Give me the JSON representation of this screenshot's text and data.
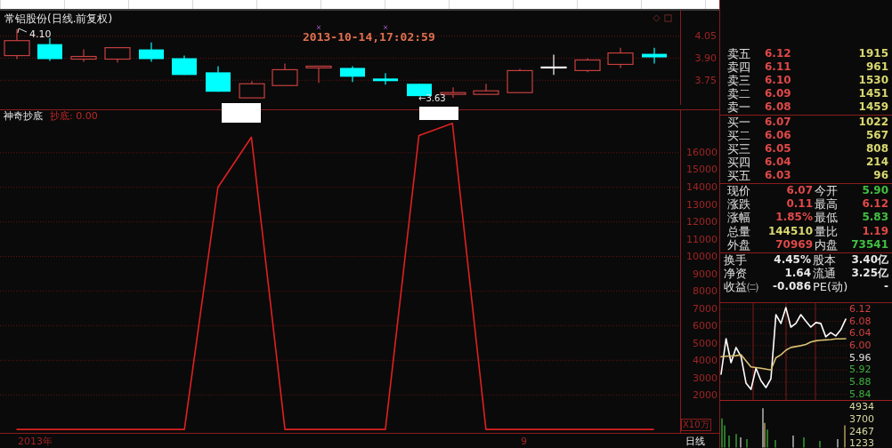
{
  "price_chart": {
    "title": "常铝股份(日线.前复权)",
    "high_label": "4.10",
    "low_label": "←3.63",
    "timestamp": "2013-10-14,17:02:59",
    "price_ticks": [
      "4.05",
      "3.90",
      "3.75"
    ]
  },
  "indicator": {
    "name": "神奇抄底",
    "value_label": "抄底: 0.00",
    "unit_label": "X10万",
    "chart_data": {
      "type": "line",
      "categories": [
        null,
        null,
        null,
        null,
        null,
        null,
        null,
        null,
        null,
        null,
        null,
        null,
        null,
        null,
        null,
        null,
        null,
        null,
        null,
        null
      ],
      "series": [
        {
          "color": "#e02020",
          "values": [
            0,
            0,
            0,
            0,
            0,
            0,
            14000,
            16900,
            0,
            0,
            0,
            0,
            17000,
            17700,
            0,
            0,
            0,
            0,
            0,
            0
          ]
        }
      ],
      "ylim": [
        -200,
        18460
      ],
      "grid": true,
      "yticks": [
        2000,
        3000,
        4000,
        5000,
        6000,
        7000,
        8000,
        9000,
        10000,
        11000,
        12000,
        13000,
        14000,
        15000,
        16000
      ]
    }
  },
  "time_axis": [
    "2013年",
    "9"
  ],
  "period_label": "日线",
  "order_book": {
    "asks": [
      {
        "label": "卖五",
        "price": "6.12",
        "volume": "1915"
      },
      {
        "label": "卖四",
        "price": "6.11",
        "volume": "961"
      },
      {
        "label": "卖三",
        "price": "6.10",
        "volume": "1530"
      },
      {
        "label": "卖二",
        "price": "6.09",
        "volume": "1451"
      },
      {
        "label": "卖一",
        "price": "6.08",
        "volume": "1459"
      }
    ],
    "bids": [
      {
        "label": "买一",
        "price": "6.07",
        "volume": "1022"
      },
      {
        "label": "买二",
        "price": "6.06",
        "volume": "567"
      },
      {
        "label": "买三",
        "price": "6.05",
        "volume": "808"
      },
      {
        "label": "买四",
        "price": "6.04",
        "volume": "214"
      },
      {
        "label": "买五",
        "price": "6.03",
        "volume": "96"
      }
    ]
  },
  "stats": [
    [
      {
        "label": "现价",
        "value": "6.07",
        "color": "#e04848"
      },
      {
        "label": "今开",
        "value": "5.90",
        "color": "#40c040"
      }
    ],
    [
      {
        "label": "涨跌",
        "value": "0.11",
        "color": "#e04848"
      },
      {
        "label": "最高",
        "value": "6.12",
        "color": "#e04848"
      }
    ],
    [
      {
        "label": "涨幅",
        "value": "1.85%",
        "color": "#e04848"
      },
      {
        "label": "最低",
        "value": "5.83",
        "color": "#40c040"
      }
    ],
    [
      {
        "label": "总量",
        "value": "144510",
        "color": "#d8d870"
      },
      {
        "label": "量比",
        "value": "1.19",
        "color": "#e04848"
      }
    ],
    [
      {
        "label": "外盘",
        "value": "70969",
        "color": "#e04848"
      },
      {
        "label": "内盘",
        "value": "73541",
        "color": "#40c040"
      }
    ]
  ],
  "fundamentals": [
    [
      {
        "label": "换手",
        "value": "4.45%"
      },
      {
        "label": "股本",
        "value": "3.40亿"
      }
    ],
    [
      {
        "label": "净资",
        "value": "1.64"
      },
      {
        "label": "流通",
        "value": "3.25亿"
      }
    ],
    [
      {
        "label": "收益㈡",
        "value": "-0.086"
      },
      {
        "label": "PE(动)",
        "value": "-"
      }
    ]
  ],
  "intraday": {
    "chart_data": {
      "type": "line",
      "categories": [
        null,
        null,
        null,
        null,
        null,
        null,
        null,
        null,
        null,
        null,
        null,
        null,
        null,
        null,
        null,
        null,
        null,
        null,
        null,
        null,
        null,
        null,
        null,
        null,
        null,
        null
      ],
      "series": [
        {
          "color": "#ffffff",
          "values": [
            5.906,
            6.023,
            5.944,
            5.994,
            5.964,
            5.877,
            5.856,
            5.926,
            5.885,
            5.862,
            5.891,
            6.102,
            6.073,
            6.125,
            6.061,
            6.073,
            6.102,
            6.081,
            6.061,
            6.076,
            6.073,
            6.029,
            6.043,
            6.032,
            6.052,
            6.087
          ]
        },
        {
          "color": "#d8c070",
          "values": [
            5.964,
            5.965,
            5.966,
            5.967,
            5.97,
            5.95,
            5.93,
            5.928,
            5.926,
            5.923,
            5.92,
            5.96,
            5.97,
            5.985,
            5.994,
            5.997,
            6.0,
            6.004,
            6.012,
            6.016,
            6.018,
            6.019,
            6.02,
            6.022,
            6.022,
            6.023
          ]
        }
      ],
      "ylim": [
        5.82,
        6.14
      ],
      "grid": true,
      "yticks": [
        {
          "value": 6.12,
          "label": "6.12"
        },
        {
          "value": 6.08,
          "label": "6.08"
        },
        {
          "value": 6.04,
          "label": "6.04"
        },
        {
          "value": 6.0,
          "label": "6.00"
        },
        {
          "value": 5.96,
          "label": "5.96"
        },
        {
          "value": 5.92,
          "label": "5.92"
        },
        {
          "value": 5.88,
          "label": "5.88"
        },
        {
          "value": 5.84,
          "label": "5.84"
        }
      ]
    },
    "tick_styles": [
      {
        "color": "#d04040"
      },
      {
        "color": "#d04040"
      },
      {
        "color": "#d04040"
      },
      {
        "color": "#d04040"
      },
      {
        "color": "#e0e0e0"
      },
      {
        "color": "#40b040"
      },
      {
        "color": "#40b040"
      },
      {
        "color": "#40b040"
      }
    ],
    "volume_ticks": [
      "4934",
      "3700",
      "2467",
      "1233"
    ]
  }
}
